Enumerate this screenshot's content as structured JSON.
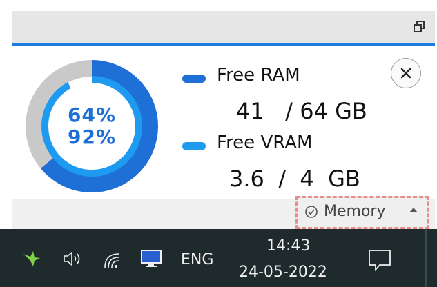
{
  "widget": {
    "ram_percent": "64%",
    "vram_percent": "92%",
    "ram_fraction": 0.64,
    "vram_fraction": 0.92,
    "ram_label": "Free RAM",
    "ram_value": "41   / 64 GB",
    "vram_label": "Free VRAM",
    "vram_value": "3.6  /  4  GB"
  },
  "memory_dropdown": {
    "label": "Memory"
  },
  "taskbar": {
    "language": "ENG",
    "time": "14:43",
    "date": "24-05-2022"
  },
  "colors": {
    "ram": "#1e6fd6",
    "vram": "#1e9af0",
    "track": "#c9c9c9",
    "taskbar": "#1e2a2c"
  },
  "icons": [
    "restore-icon",
    "close-icon",
    "check-circle-icon",
    "caret-up-icon",
    "app-bird-icon",
    "speaker-icon",
    "wifi-icon",
    "monitor-icon",
    "notification-icon"
  ]
}
